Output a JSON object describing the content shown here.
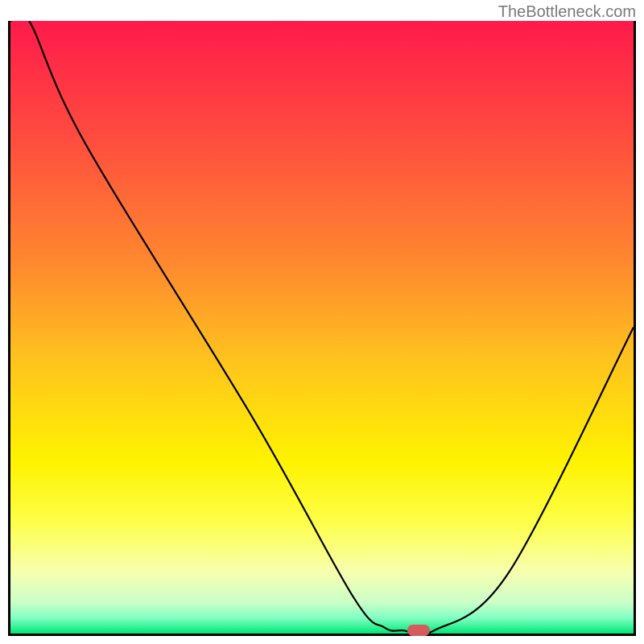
{
  "watermark": "TheBottleneck.com",
  "chart_data": {
    "type": "line",
    "title": "",
    "xlabel": "",
    "ylabel": "",
    "xlim": [
      0,
      100
    ],
    "ylim": [
      0,
      100
    ],
    "x": [
      0,
      3,
      12,
      39,
      55,
      60,
      63,
      68,
      80,
      100
    ],
    "values": [
      100,
      100,
      80,
      35,
      6,
      1,
      0.5,
      0.5,
      10,
      50
    ],
    "marker_point": {
      "x": 65.5,
      "y": 0.5
    },
    "gradient_stops": [
      {
        "offset": 0.0,
        "color": "#ff1a4a"
      },
      {
        "offset": 0.2,
        "color": "#ff4f3e"
      },
      {
        "offset": 0.4,
        "color": "#ff8a2e"
      },
      {
        "offset": 0.55,
        "color": "#ffc21e"
      },
      {
        "offset": 0.72,
        "color": "#fff300"
      },
      {
        "offset": 0.82,
        "color": "#fdff4a"
      },
      {
        "offset": 0.9,
        "color": "#f7ffb0"
      },
      {
        "offset": 0.95,
        "color": "#c9ffc9"
      },
      {
        "offset": 0.975,
        "color": "#7fffc1"
      },
      {
        "offset": 1.0,
        "color": "#00e676"
      }
    ]
  }
}
